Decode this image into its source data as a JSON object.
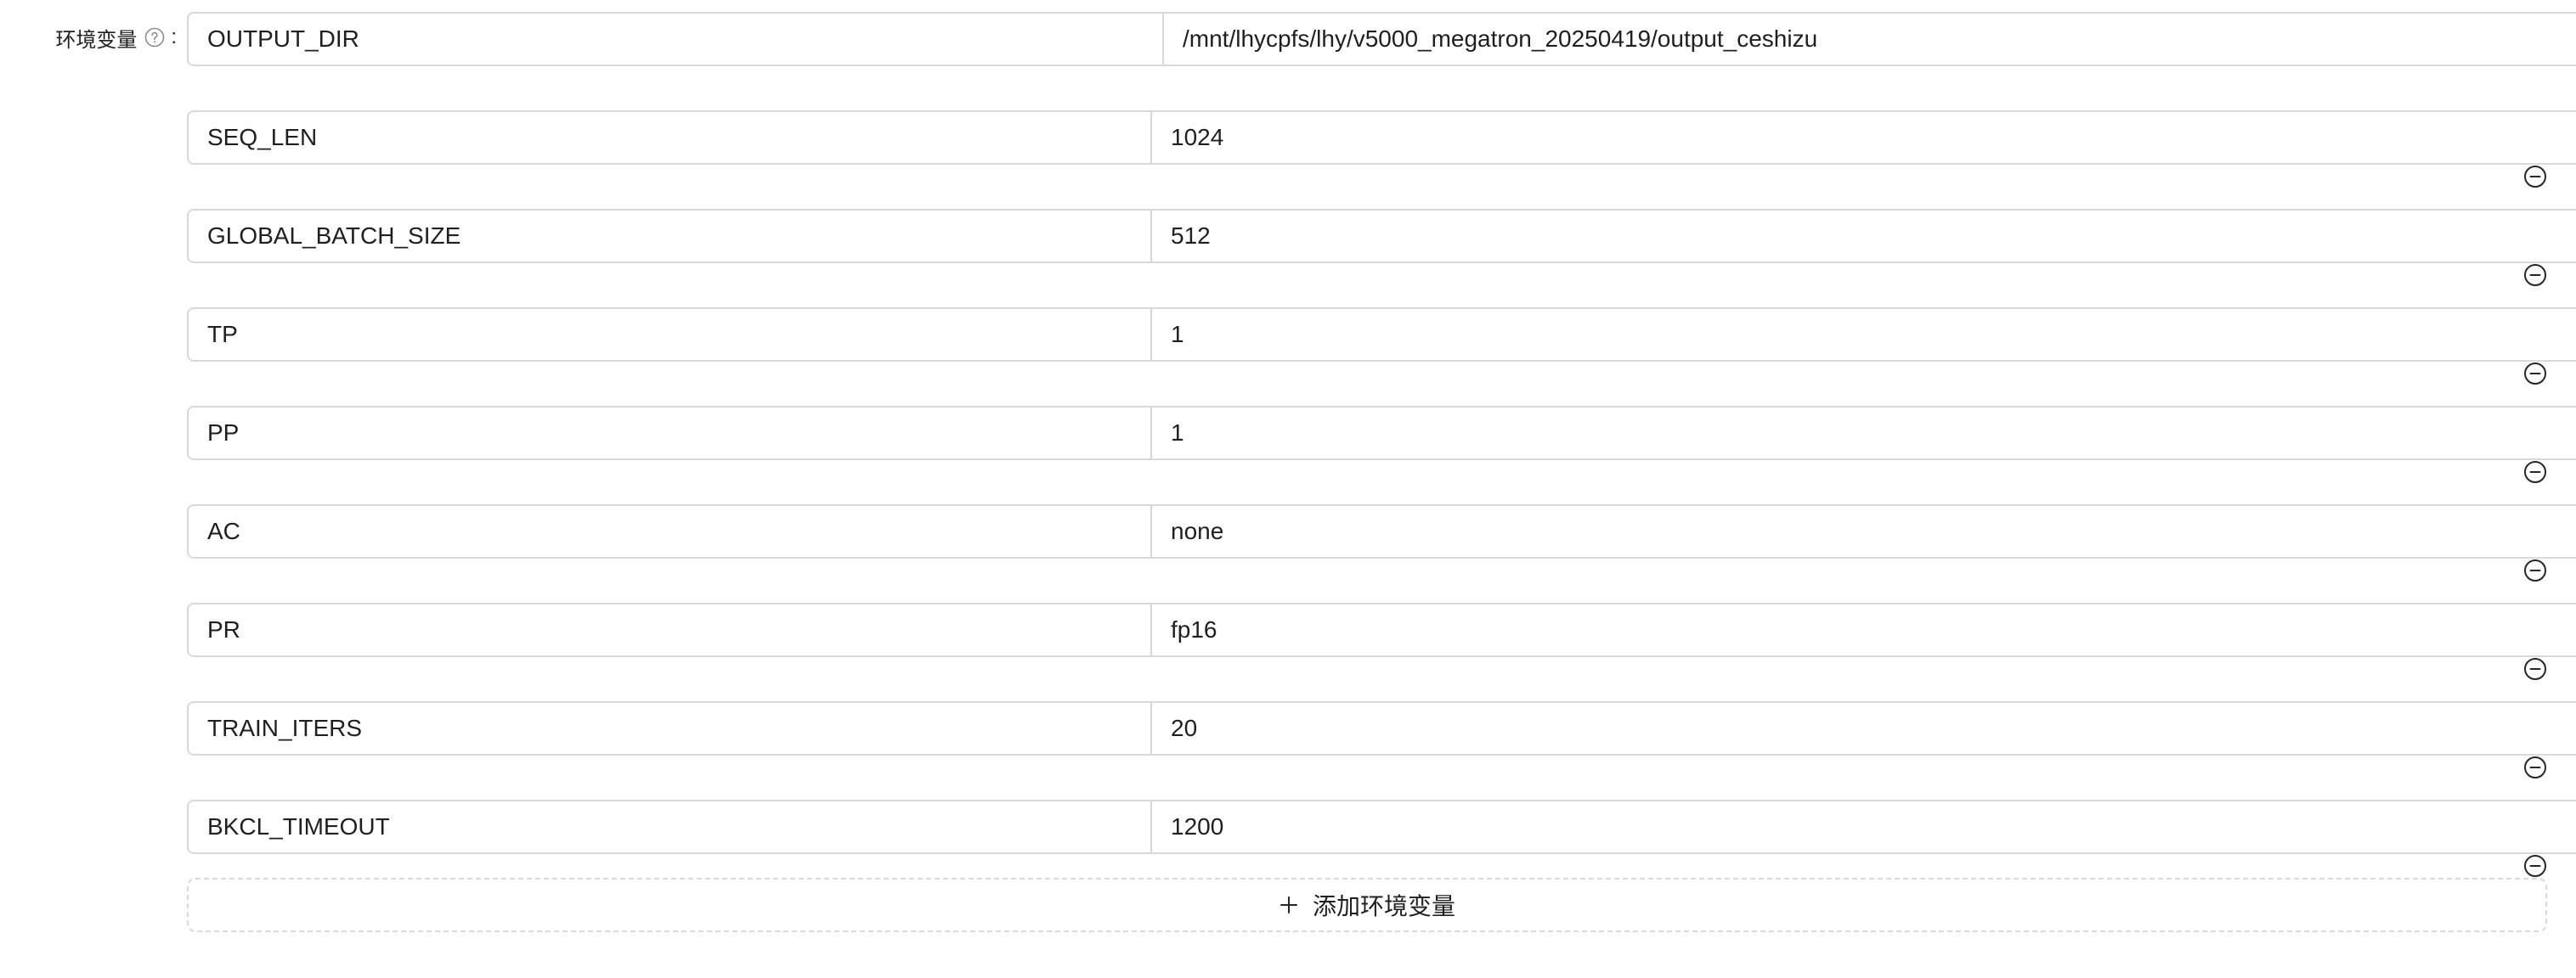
{
  "form": {
    "label": "环境变量",
    "colon": ":",
    "help_icon": "question-circle-icon",
    "remove_icon": "minus-circle-icon",
    "add_button_label": "添加环境变量",
    "add_icon": "plus-icon",
    "env_vars": [
      {
        "key": "OUTPUT_DIR",
        "value": "/mnt/lhycpfs/lhy/v5000_megatron_20250419/output_ceshizu",
        "removable": false
      },
      {
        "key": "SEQ_LEN",
        "value": "1024",
        "removable": true
      },
      {
        "key": "GLOBAL_BATCH_SIZE",
        "value": "512",
        "removable": true
      },
      {
        "key": "TP",
        "value": "1",
        "removable": true
      },
      {
        "key": "PP",
        "value": "1",
        "removable": true
      },
      {
        "key": "AC",
        "value": "none",
        "removable": true
      },
      {
        "key": "PR",
        "value": "fp16",
        "removable": true
      },
      {
        "key": "TRAIN_ITERS",
        "value": "20",
        "removable": true
      },
      {
        "key": "BKCL_TIMEOUT",
        "value": "1200",
        "removable": true
      }
    ]
  },
  "colors": {
    "border": "#d9d9d9",
    "text": "#1f1f1f",
    "icon": "#262626"
  }
}
